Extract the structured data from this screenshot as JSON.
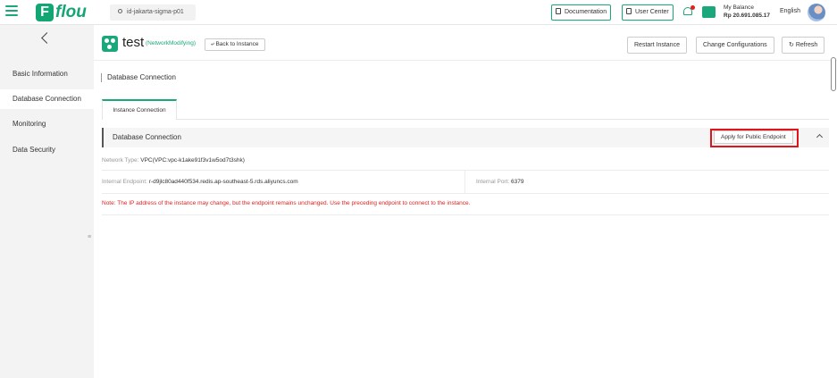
{
  "brand": {
    "logo_letter": "F",
    "name": "flou",
    "color": "#12a672"
  },
  "topbar": {
    "region": "id-jakarta-sigma-p01",
    "documentation": "Documentation",
    "user_center": "User Center",
    "balance_label": "My Balance",
    "balance_amount": "Rp 20.691.085.17",
    "language": "English"
  },
  "sidebar": {
    "items": [
      {
        "label": "Basic Information"
      },
      {
        "label": "Database Connection",
        "active": true
      },
      {
        "label": "Monitoring"
      },
      {
        "label": "Data Security"
      }
    ],
    "toggle_glyph": "≡"
  },
  "instance": {
    "name": "test",
    "status": "(NetworkModifying)",
    "back_label": "Back to Instance",
    "actions": {
      "restart": "Restart Instance",
      "change_config": "Change Configurations",
      "refresh": "Refresh"
    }
  },
  "page_title": "Database Connection",
  "tabs": [
    {
      "label": "Instance Connection",
      "active": true
    }
  ],
  "section": {
    "title": "Database Connection",
    "apply_button": "Apply for Public Endpoint",
    "network_type_label": "Network Type:",
    "network_type_value": "VPC(VPC:vpc-k1ake91f3v1w5od7t3shk)",
    "internal_endpoint_label": "Internal Endpoint:",
    "internal_endpoint_value": "r-d9jlc80ad440f534.redis.ap-southeast-5.rds.aliyuncs.com",
    "internal_port_label": "Internal Port:",
    "internal_port_value": "6379",
    "note_label": "Note:",
    "note_text": "The IP address of the instance may change, but the endpoint remains unchanged. Use the preceding endpoint to connect to the instance."
  },
  "colors": {
    "accent": "#1aa77c",
    "highlight": "#e0151b",
    "note": "#e02020"
  }
}
